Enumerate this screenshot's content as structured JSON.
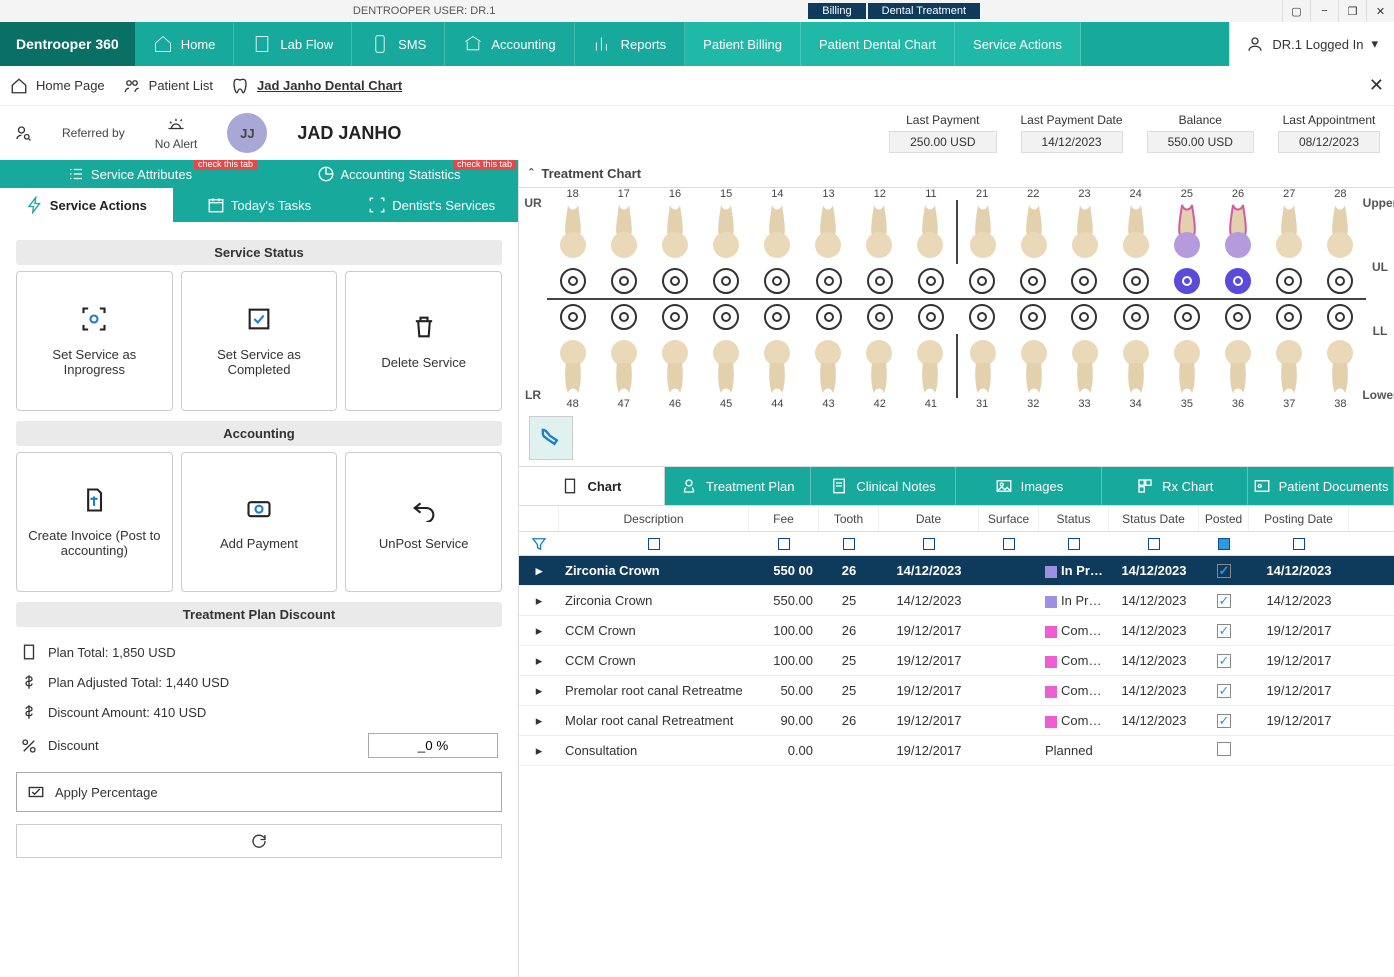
{
  "app": {
    "title": "DENTROOPER USER: DR.1",
    "brand": "Dentrooper 360"
  },
  "title_tabs": [
    "Billing",
    "Dental Treatment"
  ],
  "user": "DR.1 Logged In",
  "ribbon": [
    {
      "label": "Home"
    },
    {
      "label": "Lab Flow"
    },
    {
      "label": "SMS"
    },
    {
      "label": "Accounting"
    },
    {
      "label": "Reports"
    },
    {
      "label": "Patient Billing"
    },
    {
      "label": "Patient Dental Chart"
    },
    {
      "label": "Service Actions"
    }
  ],
  "breadcrumb": {
    "home": "Home Page",
    "patient_list": "Patient List",
    "chart": "Jad Janho Dental Chart"
  },
  "patient": {
    "referred_label": "Referred by",
    "no_alert": "No Alert",
    "initials": "JJ",
    "name": "JAD JANHO",
    "stats": [
      {
        "label": "Last Payment",
        "value": "250.00 USD"
      },
      {
        "label": "Last Payment Date",
        "value": "14/12/2023"
      },
      {
        "label": "Balance",
        "value": "550.00 USD"
      },
      {
        "label": "Last Appointment",
        "value": "08/12/2023"
      }
    ]
  },
  "left_tabs1": [
    {
      "label": "Service Attributes",
      "badge": "check this tab"
    },
    {
      "label": "Accounting Statistics",
      "badge": "check this tab"
    }
  ],
  "left_tabs2": [
    {
      "label": "Service Actions",
      "sel": true
    },
    {
      "label": "Today's Tasks"
    },
    {
      "label": "Dentist's Services"
    }
  ],
  "sections": {
    "service_status": {
      "title": "Service Status",
      "tiles": [
        "Set Service as Inprogress",
        "Set Service as Completed",
        "Delete Service"
      ]
    },
    "accounting": {
      "title": "Accounting",
      "tiles": [
        "Create Invoice (Post to accounting)",
        "Add Payment",
        "UnPost Service"
      ]
    },
    "discount_title": "Treatment Plan Discount"
  },
  "plan": {
    "total": "Plan Total: 1,850 USD",
    "adjusted": "Plan Adjusted Total: 1,440 USD",
    "discount": "Discount Amount: 410 USD",
    "percent_label": "Discount",
    "percent_value": "_0 %",
    "apply": "Apply Percentage"
  },
  "treatment_chart": {
    "title": "Treatment Chart"
  },
  "teeth": {
    "upper_nums_left": [
      "18",
      "17",
      "16",
      "15",
      "14",
      "13",
      "12",
      "11"
    ],
    "upper_nums_right": [
      "21",
      "22",
      "23",
      "24",
      "25",
      "26",
      "27",
      "28"
    ],
    "lower_nums_left": [
      "48",
      "47",
      "46",
      "45",
      "44",
      "43",
      "42",
      "41"
    ],
    "lower_nums_right": [
      "31",
      "32",
      "33",
      "34",
      "35",
      "36",
      "37",
      "38"
    ],
    "UR": "UR",
    "UL": "UL",
    "LR": "LR",
    "LL": "LL",
    "Upper": "Upper",
    "Lower": "Lower",
    "highlighted": [
      "25",
      "26"
    ]
  },
  "lower_tabs": [
    "Chart",
    "Treatment Plan",
    "Clinical Notes",
    "Images",
    "Rx Chart",
    "Patient Documents"
  ],
  "grid": {
    "columns": [
      "",
      "Description",
      "Fee",
      "Tooth",
      "Date",
      "Surface",
      "Status",
      "Status Date",
      "Posted",
      "Posting Date"
    ],
    "rows": [
      {
        "desc": "Zirconia Crown",
        "fee": "550 00",
        "tooth": "26",
        "date": "14/12/2023",
        "surf": "",
        "status": "In Progr",
        "status_color": "purple",
        "sdate": "14/12/2023",
        "posted": true,
        "pdate": "14/12/2023",
        "sel": true
      },
      {
        "desc": "Zirconia Crown",
        "fee": "550.00",
        "tooth": "25",
        "date": "14/12/2023",
        "surf": "",
        "status": "In Progre",
        "status_color": "purple",
        "sdate": "14/12/2023",
        "posted": true,
        "pdate": "14/12/2023"
      },
      {
        "desc": "CCM Crown",
        "fee": "100.00",
        "tooth": "26",
        "date": "19/12/2017",
        "surf": "",
        "status": "Comple",
        "status_color": "pink",
        "sdate": "14/12/2023",
        "posted": true,
        "pdate": "19/12/2017"
      },
      {
        "desc": "CCM Crown",
        "fee": "100.00",
        "tooth": "25",
        "date": "19/12/2017",
        "surf": "",
        "status": "Comple",
        "status_color": "pink",
        "sdate": "14/12/2023",
        "posted": true,
        "pdate": "19/12/2017"
      },
      {
        "desc": "Premolar root canal Retreatme",
        "fee": "50.00",
        "tooth": "25",
        "date": "19/12/2017",
        "surf": "",
        "status": "Comple",
        "status_color": "pink",
        "sdate": "14/12/2023",
        "posted": true,
        "pdate": "19/12/2017"
      },
      {
        "desc": "Molar root canal Retreatment",
        "fee": "90.00",
        "tooth": "26",
        "date": "19/12/2017",
        "surf": "",
        "status": "Comple",
        "status_color": "pink",
        "sdate": "14/12/2023",
        "posted": true,
        "pdate": "19/12/2017"
      },
      {
        "desc": "Consultation",
        "fee": "0.00",
        "tooth": "",
        "date": "19/12/2017",
        "surf": "",
        "status": "Planned",
        "status_color": "",
        "sdate": "",
        "posted": false,
        "pdate": ""
      }
    ]
  }
}
